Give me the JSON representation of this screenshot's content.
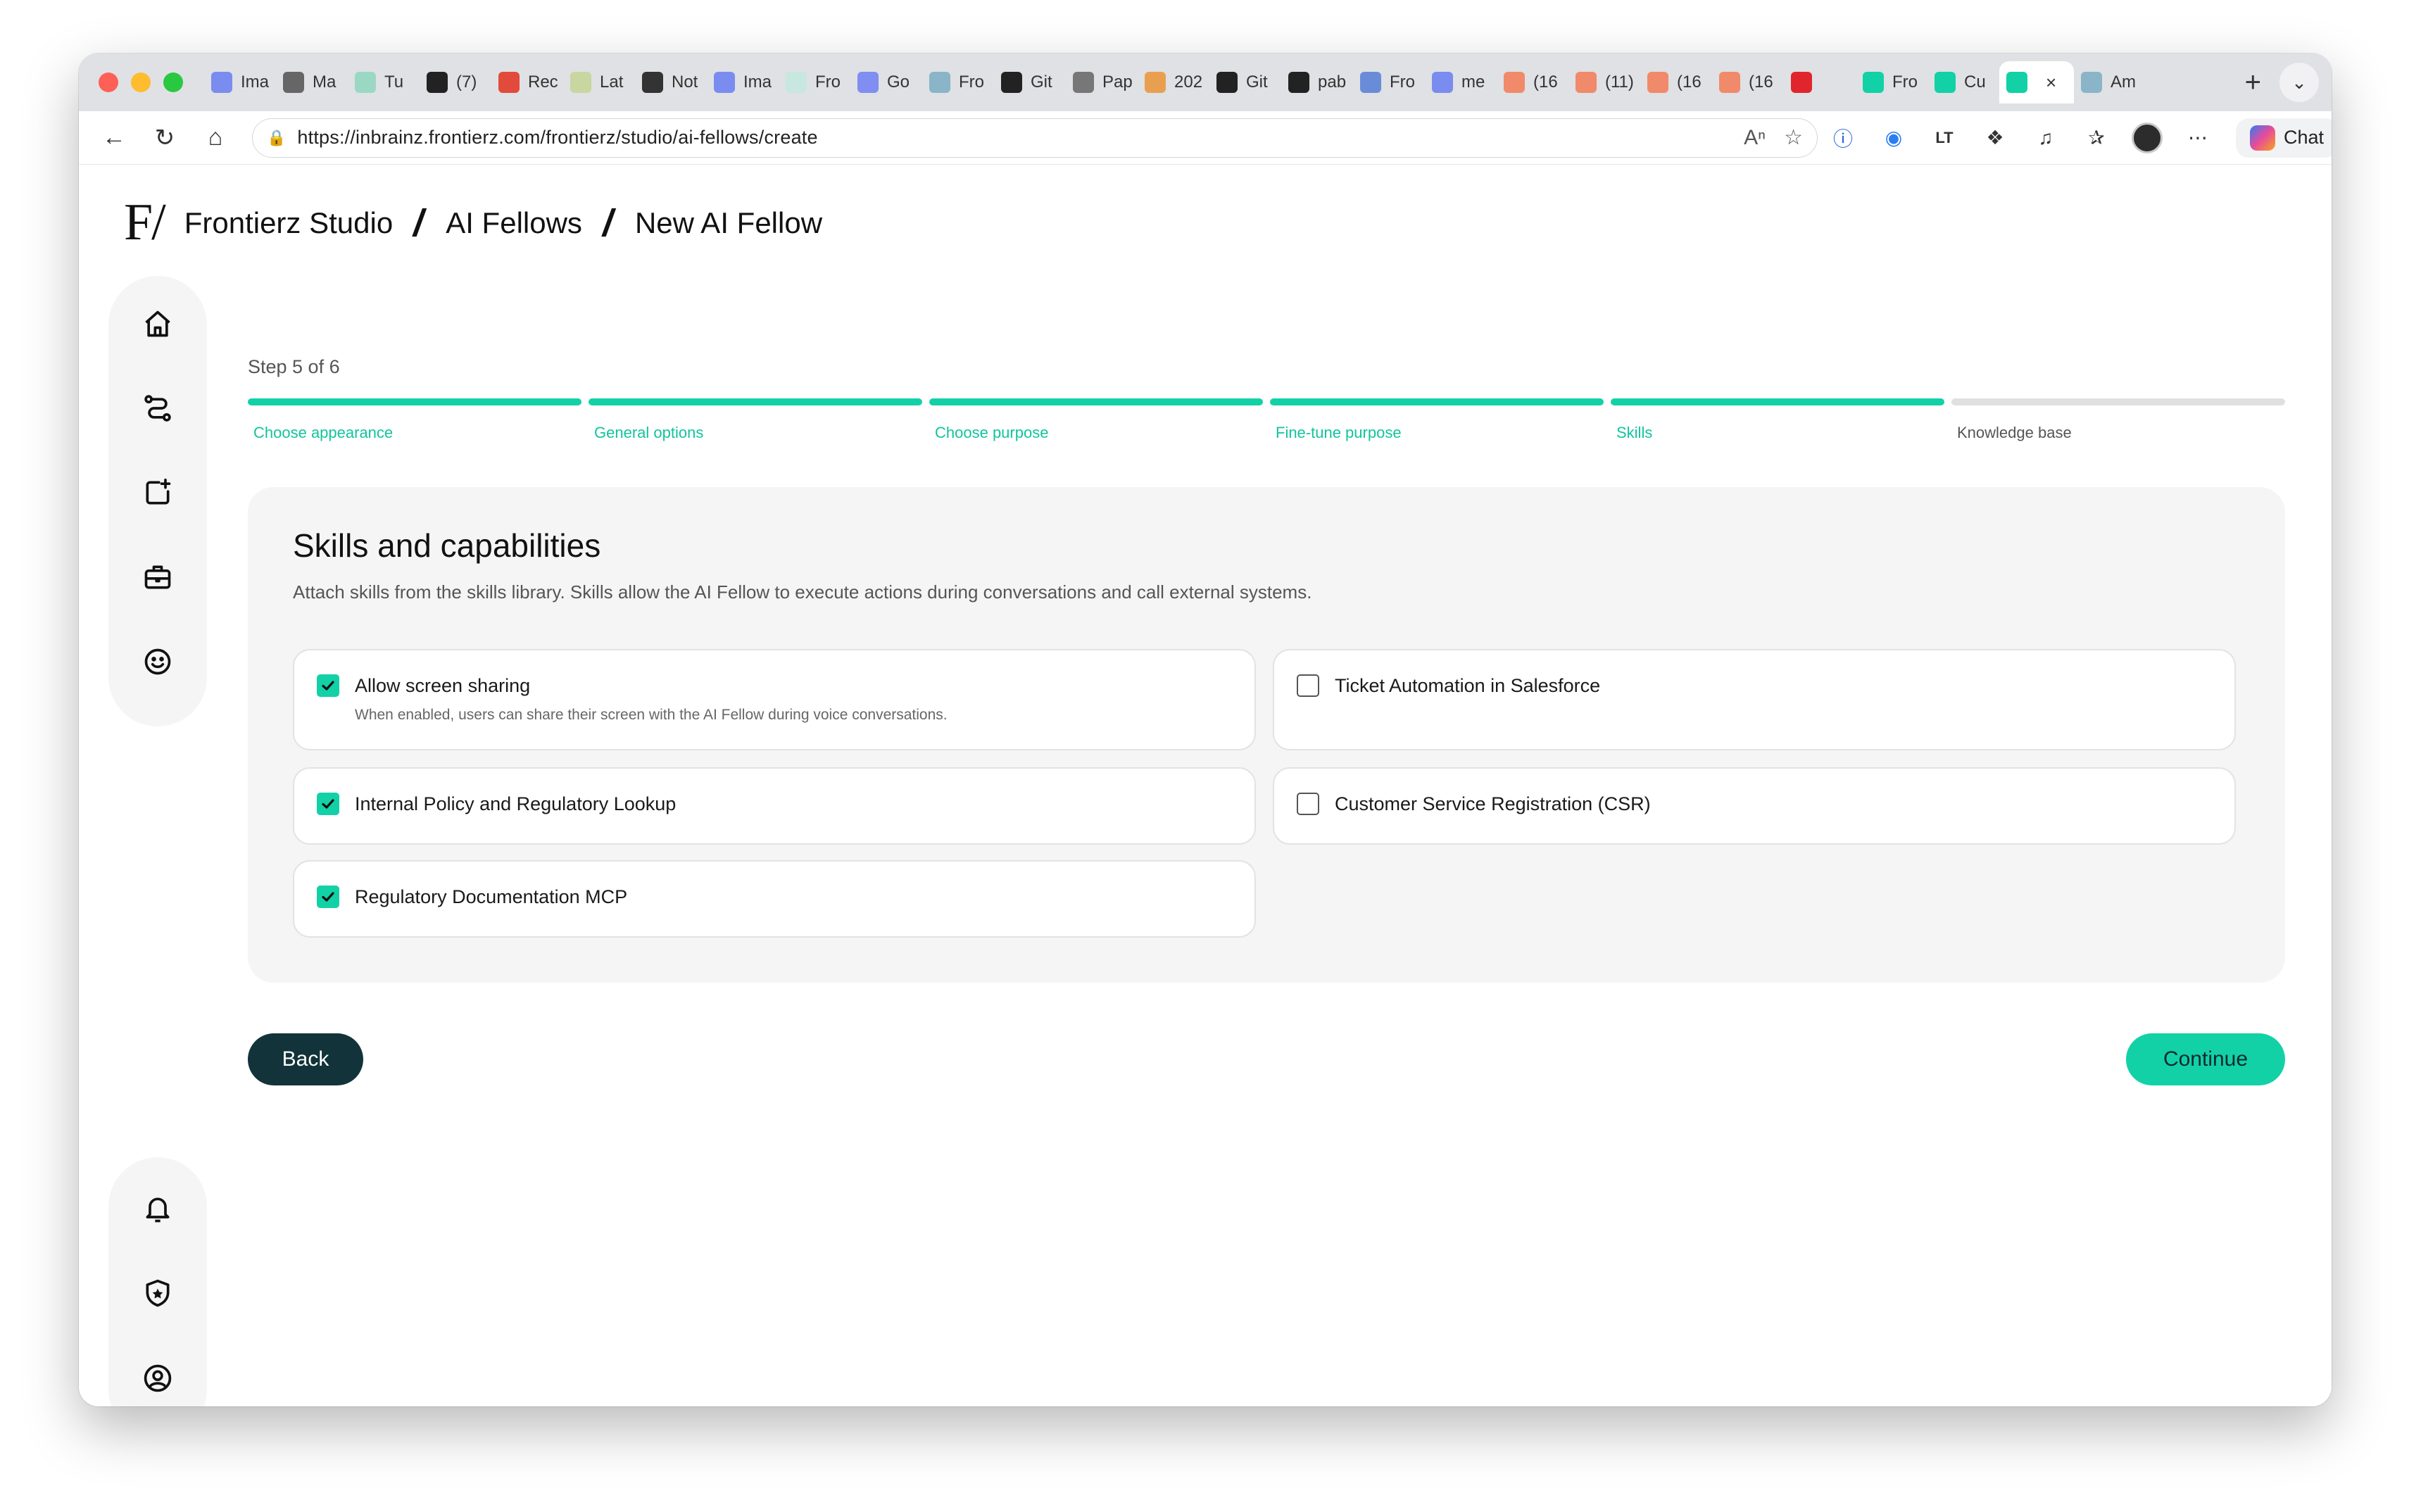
{
  "browser": {
    "traffic_colors": [
      "#fe5f57",
      "#febc2e",
      "#28c840"
    ],
    "tabs": [
      {
        "label": "Ima",
        "icon": "doc-icon",
        "color": "#7b8cf0"
      },
      {
        "label": "Ma",
        "icon": "mountain-icon",
        "color": "#666666"
      },
      {
        "label": "Tu",
        "icon": "frontierz-icon",
        "color": "#9bd8c4"
      },
      {
        "label": "(7)",
        "icon": "x-logo-icon",
        "color": "#222222"
      },
      {
        "label": "Rec",
        "icon": "gmail-icon",
        "color": "#e24a3b"
      },
      {
        "label": "Lat",
        "icon": "sparkle-icon",
        "color": "#c8d6a0"
      },
      {
        "label": "Not",
        "icon": "openai-icon",
        "color": "#333333"
      },
      {
        "label": "Ima",
        "icon": "doc-icon",
        "color": "#7b8cf0"
      },
      {
        "label": "Fro",
        "icon": "frontierz-icon",
        "color": "#c8e8df"
      },
      {
        "label": "Go",
        "icon": "gemini-icon",
        "color": "#7f8ef0"
      },
      {
        "label": "Fro",
        "icon": "cloud-icon",
        "color": "#8ab4c8"
      },
      {
        "label": "Git",
        "icon": "github-icon",
        "color": "#222222"
      },
      {
        "label": "Pap",
        "icon": "paper-icon",
        "color": "#777777"
      },
      {
        "label": "202",
        "icon": "grid-icon",
        "color": "#e8a050"
      },
      {
        "label": "Git",
        "icon": "github-icon",
        "color": "#222222"
      },
      {
        "label": "pab",
        "icon": "github-icon",
        "color": "#222222"
      },
      {
        "label": "Fro",
        "icon": "tools-icon",
        "color": "#6a8cd8"
      },
      {
        "label": "me",
        "icon": "mail-icon",
        "color": "#7a8cf0"
      },
      {
        "label": "(16",
        "icon": "youtube-icon",
        "color": "#f08a6a"
      },
      {
        "label": "(11)",
        "icon": "youtube-icon",
        "color": "#f08a6a"
      },
      {
        "label": "(16",
        "icon": "youtube-icon",
        "color": "#f08a6a"
      },
      {
        "label": "(16",
        "icon": "youtube-icon",
        "color": "#f08a6a"
      },
      {
        "label": "",
        "icon": "youtube-audio-icon",
        "color": "#e0262c"
      },
      {
        "label": "Fro",
        "icon": "frontierz-icon",
        "color": "#12d1a6"
      },
      {
        "label": "Cu",
        "icon": "frontierz-icon",
        "color": "#12d1a6"
      },
      {
        "label": "",
        "icon": "frontierz-icon",
        "color": "#12d1a6",
        "active": true
      },
      {
        "label": "Am",
        "icon": "cloud-icon",
        "color": "#8ab4c8"
      }
    ],
    "url": "https://inbrainz.frontierz.com/frontierz/studio/ai-fellows/create",
    "chat_label": "Chat"
  },
  "app": {
    "logo": "F/",
    "breadcrumb": [
      "Frontierz Studio",
      "AI Fellows",
      "New AI Fellow"
    ],
    "accent_color": "#12d1a6",
    "step_label": "Step 5 of 6",
    "steps": [
      {
        "name": "Choose appearance",
        "done": true
      },
      {
        "name": "General options",
        "done": true
      },
      {
        "name": "Choose purpose",
        "done": true
      },
      {
        "name": "Fine-tune purpose",
        "done": true
      },
      {
        "name": "Skills",
        "done": true
      },
      {
        "name": "Knowledge base",
        "done": false
      }
    ],
    "section_title": "Skills and capabilities",
    "section_description": "Attach skills from the skills library. Skills allow the AI Fellow to execute actions during conversations and call external systems.",
    "skills": [
      {
        "title": "Allow screen sharing",
        "subtitle": "When enabled, users can share their screen with the AI Fellow during voice conversations.",
        "checked": true
      },
      {
        "title": "Ticket Automation in Salesforce",
        "subtitle": "",
        "checked": false
      },
      {
        "title": "Internal Policy and Regulatory Lookup",
        "subtitle": "",
        "checked": true
      },
      {
        "title": "Customer Service Registration (CSR)",
        "subtitle": "",
        "checked": false
      },
      {
        "title": "Regulatory Documentation MCP",
        "subtitle": "",
        "checked": true
      }
    ],
    "back_label": "Back",
    "continue_label": "Continue"
  }
}
